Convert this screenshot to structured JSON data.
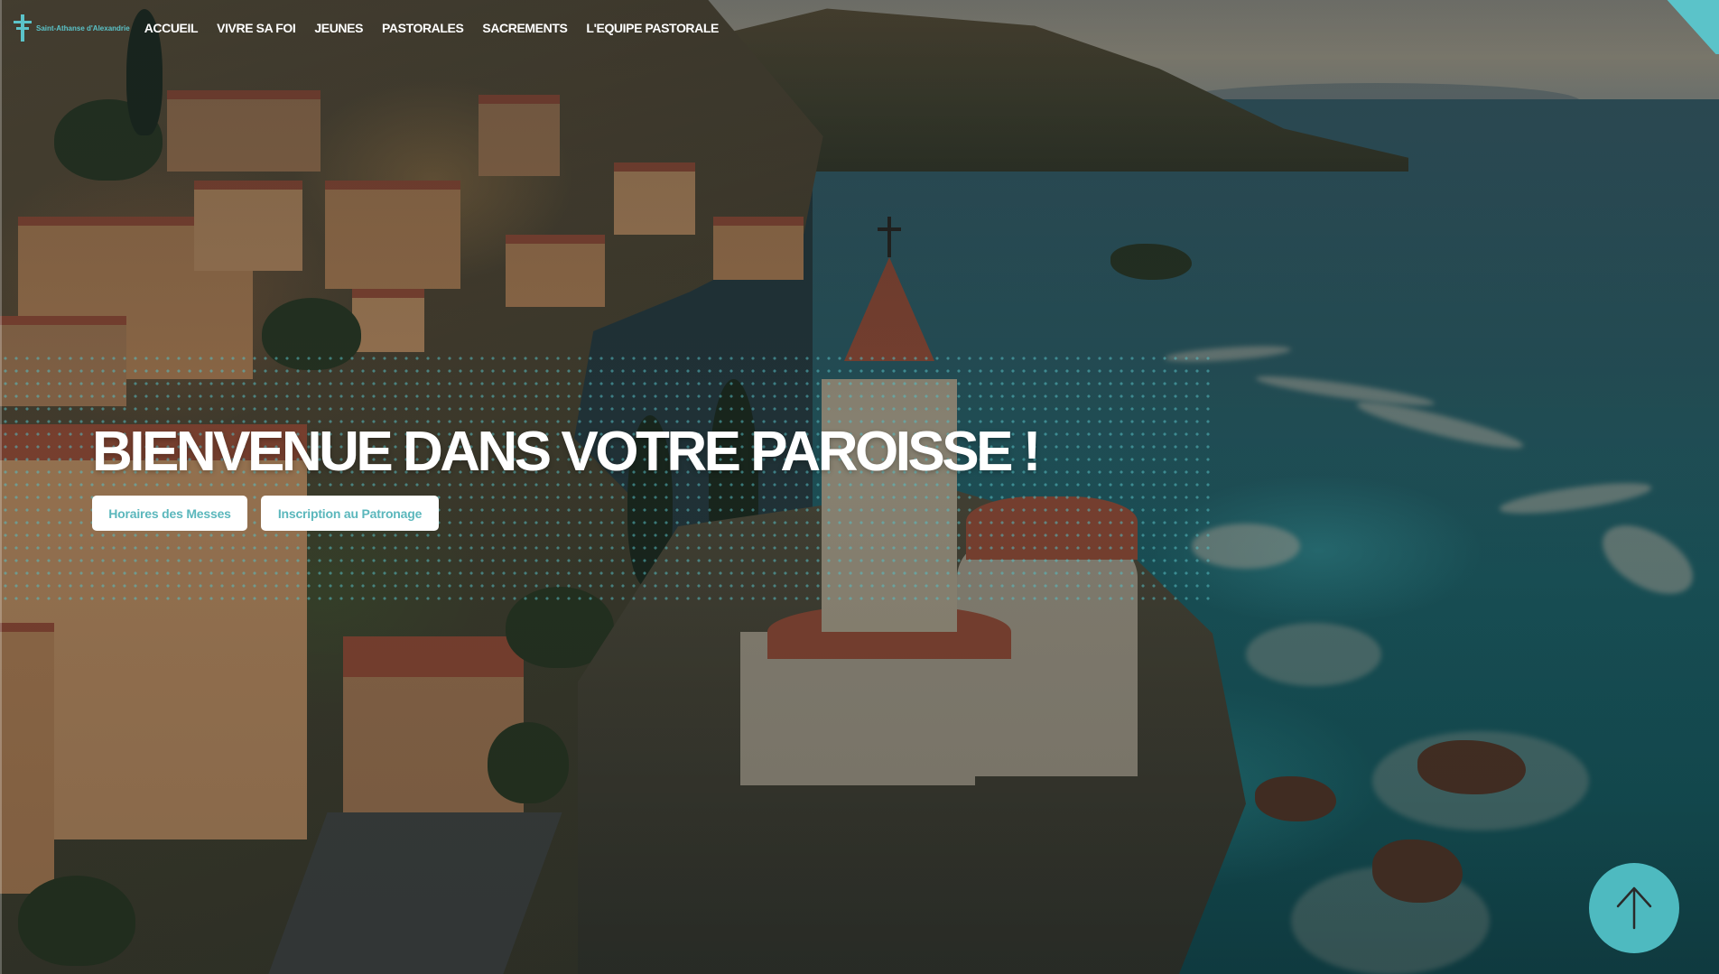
{
  "site": {
    "logo_text": "Saint-Athanse d'Alexandrie",
    "accent_color": "#5bc3c9"
  },
  "nav": {
    "items": [
      {
        "label": "ACCUEIL"
      },
      {
        "label": "VIVRE SA FOI"
      },
      {
        "label": "JEUNES"
      },
      {
        "label": "PASTORALES"
      },
      {
        "label": "SACREMENTS"
      },
      {
        "label": "L'EQUIPE PASTORALE"
      }
    ]
  },
  "hero": {
    "title": "BIENVENUE DANS VOTRE PAROISSE !",
    "buttons": [
      {
        "label": "Horaires des Messes"
      },
      {
        "label": "Inscription au Patronage"
      }
    ],
    "background_image": "aerial-coastal-church-scene"
  },
  "scroll_top": {
    "icon": "arrow-up-icon",
    "color": "#4ebac0"
  }
}
